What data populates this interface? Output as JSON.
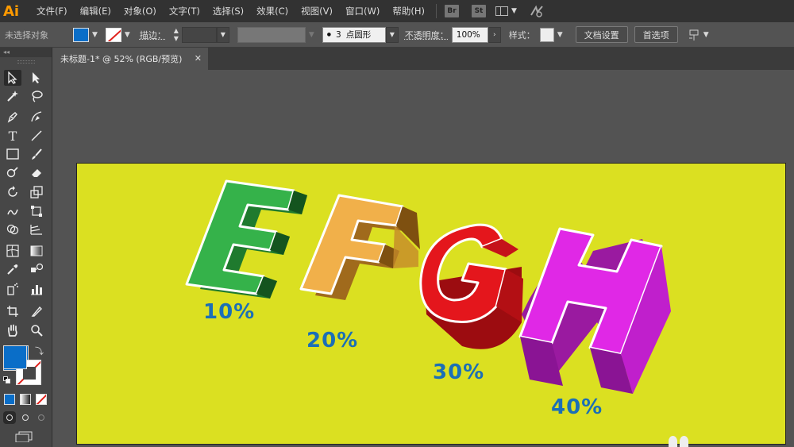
{
  "menubar": {
    "logo": "Ai",
    "items": [
      "文件(F)",
      "编辑(E)",
      "对象(O)",
      "文字(T)",
      "选择(S)",
      "效果(C)",
      "视图(V)",
      "窗口(W)",
      "帮助(H)"
    ],
    "badge_br": "Br",
    "badge_st": "St"
  },
  "controlbar": {
    "selection": "未选择对象",
    "stroke_label": "描边：",
    "brush_size": "3",
    "brush_name": "点圆形",
    "opacity_label": "不透明度：",
    "opacity_value": "100%",
    "style_label": "样式：",
    "doc_settings": "文档设置",
    "preferences": "首选项"
  },
  "tab": {
    "title": "未标题-1* @ 52% (RGB/预览)",
    "close": "✕"
  },
  "artwork": {
    "background": "#dbe021",
    "letters": [
      "E",
      "F",
      "G",
      "H"
    ],
    "colors": [
      "#2f9a3e",
      "#e8a93c",
      "#e0141b",
      "#e020e8"
    ],
    "labels": [
      "10%",
      "20%",
      "30%",
      "40%"
    ]
  },
  "colors": {
    "fill": "#0a6ec8",
    "stroke": "#e0201b",
    "label": "#1b6fb6"
  }
}
